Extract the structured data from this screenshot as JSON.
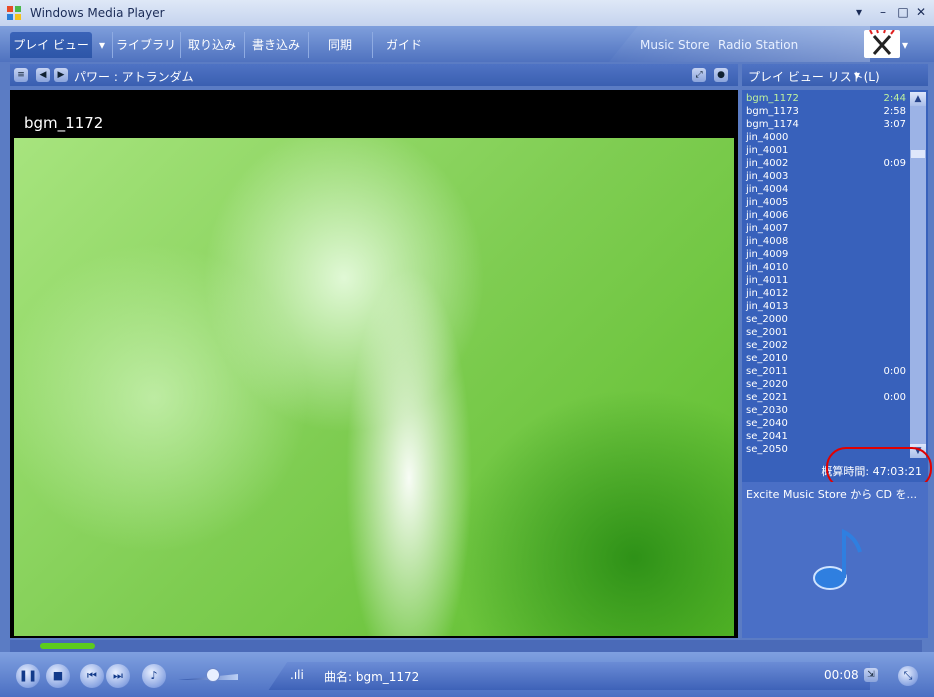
{
  "window": {
    "title": "Windows Media Player"
  },
  "nav": {
    "tabs": [
      {
        "label": "プレイ ビュー"
      },
      {
        "label": "ライブラリ"
      },
      {
        "label": "取り込み"
      },
      {
        "label": "書き込み"
      },
      {
        "label": "同期"
      },
      {
        "label": "ガイド"
      }
    ],
    "stores": [
      "Music Store",
      "Radio Station"
    ]
  },
  "now_playing": {
    "header": "パワー : アトランダム",
    "clip_title": "bgm_1172"
  },
  "playlist": {
    "header": "プレイ ビュー リスト(L)",
    "items": [
      {
        "name": "bgm_1172",
        "duration": "2:44"
      },
      {
        "name": "bgm_1173",
        "duration": "2:58"
      },
      {
        "name": "bgm_1174",
        "duration": "3:07"
      },
      {
        "name": "jin_4000",
        "duration": ""
      },
      {
        "name": "jin_4001",
        "duration": ""
      },
      {
        "name": "jin_4002",
        "duration": "0:09"
      },
      {
        "name": "jin_4003",
        "duration": ""
      },
      {
        "name": "jin_4004",
        "duration": ""
      },
      {
        "name": "jin_4005",
        "duration": ""
      },
      {
        "name": "jin_4006",
        "duration": ""
      },
      {
        "name": "jin_4007",
        "duration": ""
      },
      {
        "name": "jin_4008",
        "duration": ""
      },
      {
        "name": "jin_4009",
        "duration": ""
      },
      {
        "name": "jin_4010",
        "duration": ""
      },
      {
        "name": "jin_4011",
        "duration": ""
      },
      {
        "name": "jin_4012",
        "duration": ""
      },
      {
        "name": "jin_4013",
        "duration": ""
      },
      {
        "name": "se_2000",
        "duration": ""
      },
      {
        "name": "se_2001",
        "duration": ""
      },
      {
        "name": "se_2002",
        "duration": ""
      },
      {
        "name": "se_2010",
        "duration": ""
      },
      {
        "name": "se_2011",
        "duration": "0:00"
      },
      {
        "name": "se_2020",
        "duration": ""
      },
      {
        "name": "se_2021",
        "duration": "0:00"
      },
      {
        "name": "se_2030",
        "duration": ""
      },
      {
        "name": "se_2040",
        "duration": ""
      },
      {
        "name": "se_2041",
        "duration": ""
      },
      {
        "name": "se_2050",
        "duration": ""
      }
    ],
    "total_time": "概算時間: 47:03:21"
  },
  "excite": {
    "text": "Excite Music Store から CD を..."
  },
  "controls": {
    "track_label": "曲名: bgm_1172",
    "elapsed": "00:08",
    "seek_fraction": 0.06,
    "volume_fraction": 0.55
  },
  "colors": {
    "accent": "#3861bb",
    "highlight": "#bff29d",
    "annotation": "#e10000"
  }
}
